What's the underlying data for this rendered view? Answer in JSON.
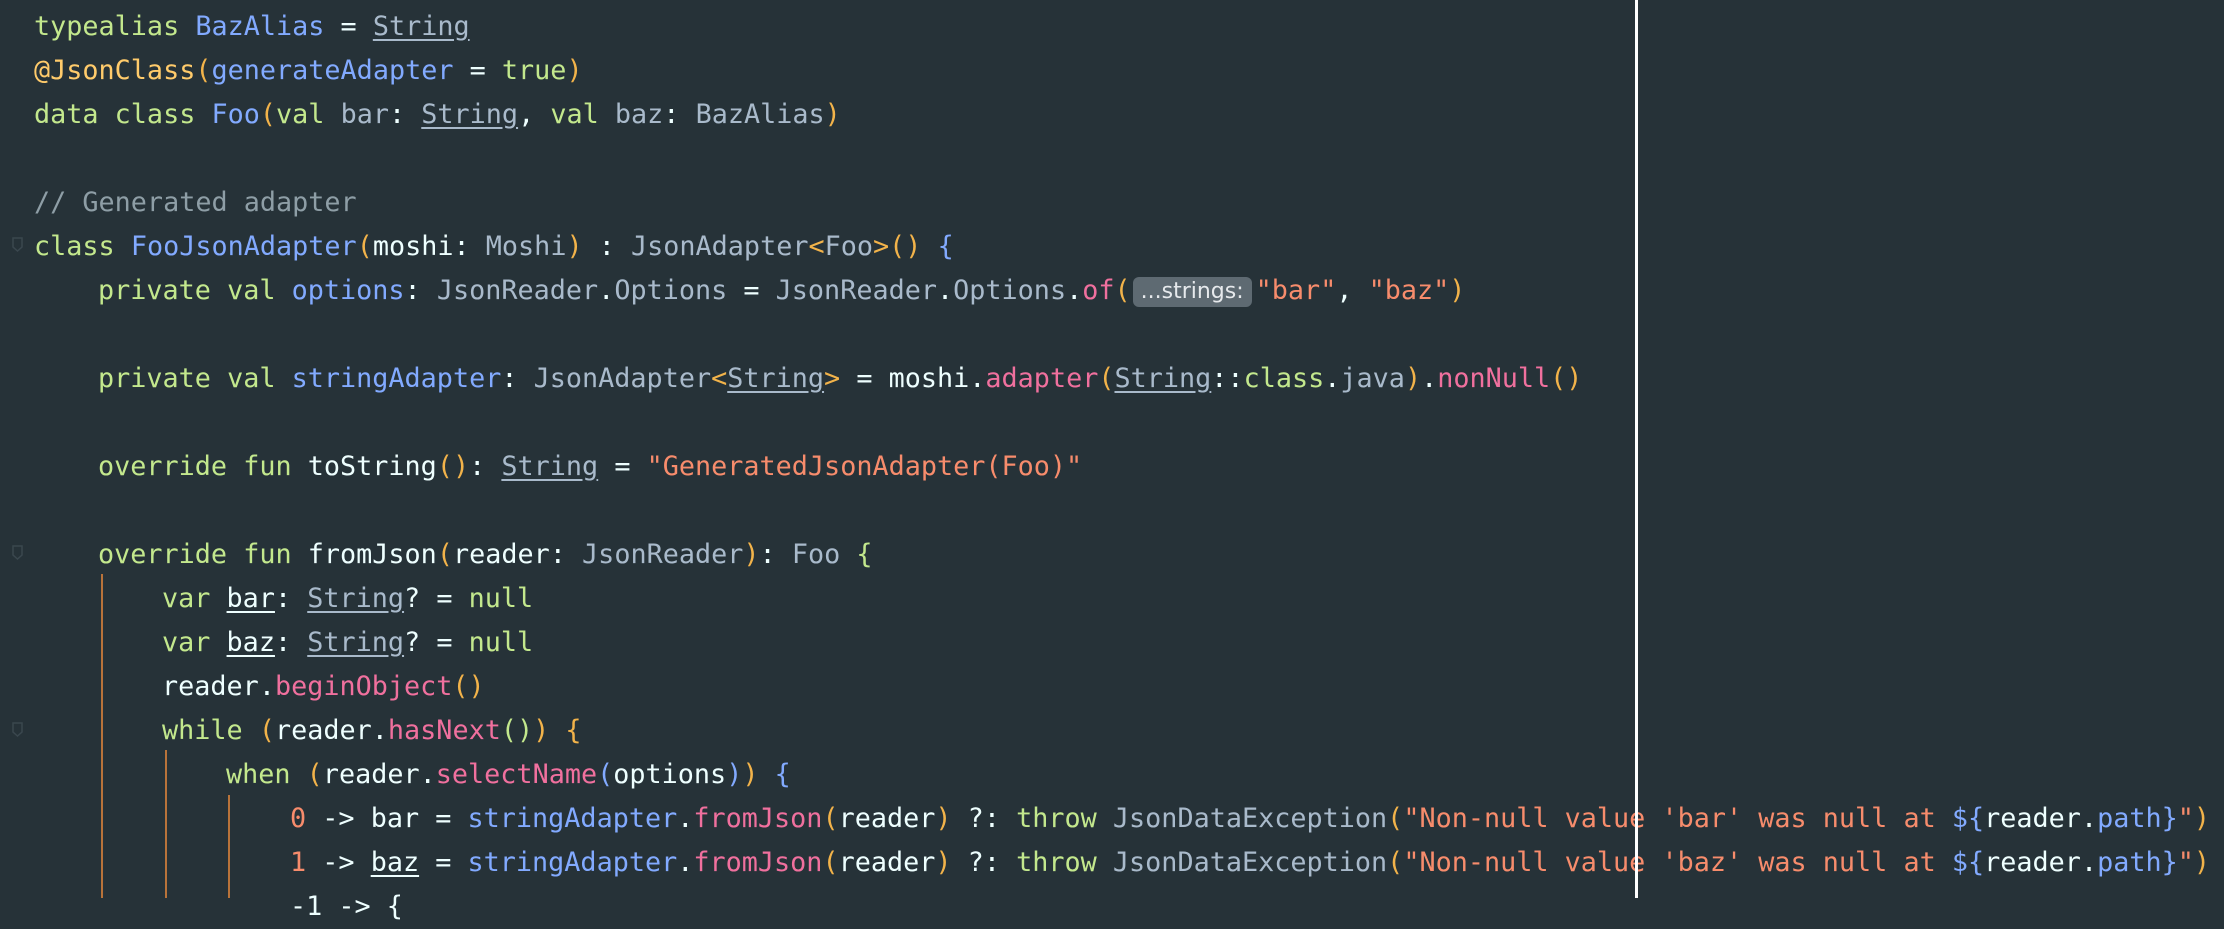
{
  "editor": {
    "lines": [
      {
        "indent": 0,
        "tokens": [
          {
            "t": "typealias ",
            "c": "kw"
          },
          {
            "t": "BazAlias",
            "c": "ty"
          },
          {
            "t": " = ",
            "c": "pl"
          },
          {
            "t": "String",
            "c": "ul"
          }
        ]
      },
      {
        "indent": 0,
        "tokens": [
          {
            "t": "@JsonClass",
            "c": "ann"
          },
          {
            "t": "(",
            "c": "par"
          },
          {
            "t": "generateAdapter",
            "c": "ty"
          },
          {
            "t": " = ",
            "c": "pl"
          },
          {
            "t": "true",
            "c": "kw"
          },
          {
            "t": ")",
            "c": "par"
          }
        ]
      },
      {
        "indent": 0,
        "tokens": [
          {
            "t": "data class ",
            "c": "kw"
          },
          {
            "t": "Foo",
            "c": "ty"
          },
          {
            "t": "(",
            "c": "par"
          },
          {
            "t": "val ",
            "c": "kw"
          },
          {
            "t": "bar",
            "c": "typ"
          },
          {
            "t": ": ",
            "c": "pl"
          },
          {
            "t": "String",
            "c": "ul"
          },
          {
            "t": ", ",
            "c": "pl"
          },
          {
            "t": "val ",
            "c": "kw"
          },
          {
            "t": "baz",
            "c": "typ"
          },
          {
            "t": ": ",
            "c": "pl"
          },
          {
            "t": "BazAlias",
            "c": "typ"
          },
          {
            "t": ")",
            "c": "par"
          }
        ]
      },
      {
        "indent": 0,
        "tokens": []
      },
      {
        "indent": 0,
        "tokens": [
          {
            "t": "// Generated adapter",
            "c": "cm"
          }
        ]
      },
      {
        "indent": 0,
        "tokens": [
          {
            "t": "class ",
            "c": "kw"
          },
          {
            "t": "FooJsonAdapter",
            "c": "ty"
          },
          {
            "t": "(",
            "c": "par"
          },
          {
            "t": "moshi",
            "c": "pl"
          },
          {
            "t": ": ",
            "c": "pl"
          },
          {
            "t": "Moshi",
            "c": "typ"
          },
          {
            "t": ")",
            "c": "par"
          },
          {
            "t": " : ",
            "c": "pl"
          },
          {
            "t": "JsonAdapter",
            "c": "typ"
          },
          {
            "t": "<",
            "c": "par"
          },
          {
            "t": "Foo",
            "c": "typ"
          },
          {
            "t": ">",
            "c": "par"
          },
          {
            "t": "()",
            "c": "par"
          },
          {
            "t": " {",
            "c": "ty"
          }
        ]
      },
      {
        "indent": 1,
        "tokens": [
          {
            "t": "private val ",
            "c": "kw"
          },
          {
            "t": "options",
            "c": "fld"
          },
          {
            "t": ": ",
            "c": "pl"
          },
          {
            "t": "JsonReader",
            "c": "typ"
          },
          {
            "t": ".",
            "c": "pl"
          },
          {
            "t": "Options",
            "c": "typ"
          },
          {
            "t": " = ",
            "c": "pl"
          },
          {
            "t": "JsonReader",
            "c": "typ"
          },
          {
            "t": ".",
            "c": "pl"
          },
          {
            "t": "Options",
            "c": "typ"
          },
          {
            "t": ".",
            "c": "pl"
          },
          {
            "t": "of",
            "c": "fn"
          },
          {
            "t": "(",
            "c": "par"
          },
          {
            "t": "...strings:",
            "c": "hint"
          },
          {
            "t": "\"bar\"",
            "c": "str"
          },
          {
            "t": ", ",
            "c": "pl"
          },
          {
            "t": "\"baz\"",
            "c": "str"
          },
          {
            "t": ")",
            "c": "par"
          }
        ]
      },
      {
        "indent": 0,
        "tokens": []
      },
      {
        "indent": 1,
        "tokens": [
          {
            "t": "private val ",
            "c": "kw"
          },
          {
            "t": "stringAdapter",
            "c": "fld"
          },
          {
            "t": ": ",
            "c": "pl"
          },
          {
            "t": "JsonAdapter",
            "c": "typ"
          },
          {
            "t": "<",
            "c": "par"
          },
          {
            "t": "String",
            "c": "ul"
          },
          {
            "t": ">",
            "c": "par"
          },
          {
            "t": " = ",
            "c": "pl"
          },
          {
            "t": "moshi",
            "c": "pl"
          },
          {
            "t": ".",
            "c": "pl"
          },
          {
            "t": "adapter",
            "c": "fn"
          },
          {
            "t": "(",
            "c": "par"
          },
          {
            "t": "String",
            "c": "ul"
          },
          {
            "t": "::",
            "c": "pl"
          },
          {
            "t": "class",
            "c": "kw"
          },
          {
            "t": ".",
            "c": "pl"
          },
          {
            "t": "java",
            "c": "typ"
          },
          {
            "t": ")",
            "c": "par"
          },
          {
            "t": ".",
            "c": "pl"
          },
          {
            "t": "nonNull",
            "c": "fn"
          },
          {
            "t": "()",
            "c": "par"
          }
        ]
      },
      {
        "indent": 0,
        "tokens": []
      },
      {
        "indent": 1,
        "tokens": [
          {
            "t": "override fun ",
            "c": "kw"
          },
          {
            "t": "toString",
            "c": "pl"
          },
          {
            "t": "()",
            "c": "par"
          },
          {
            "t": ": ",
            "c": "pl"
          },
          {
            "t": "String",
            "c": "ul"
          },
          {
            "t": " = ",
            "c": "pl"
          },
          {
            "t": "\"GeneratedJsonAdapter(Foo)\"",
            "c": "str"
          }
        ]
      },
      {
        "indent": 0,
        "tokens": []
      },
      {
        "indent": 1,
        "tokens": [
          {
            "t": "override fun ",
            "c": "kw"
          },
          {
            "t": "fromJson",
            "c": "pl"
          },
          {
            "t": "(",
            "c": "par"
          },
          {
            "t": "reader",
            "c": "pl"
          },
          {
            "t": ": ",
            "c": "pl"
          },
          {
            "t": "JsonReader",
            "c": "typ"
          },
          {
            "t": ")",
            "c": "par"
          },
          {
            "t": ": ",
            "c": "pl"
          },
          {
            "t": "Foo",
            "c": "typ"
          },
          {
            "t": " {",
            "c": "kw"
          }
        ]
      },
      {
        "indent": 2,
        "tokens": [
          {
            "t": "var ",
            "c": "kw"
          },
          {
            "t": "bar",
            "c": "ulw"
          },
          {
            "t": ": ",
            "c": "pl"
          },
          {
            "t": "String",
            "c": "ul"
          },
          {
            "t": "? = ",
            "c": "pl"
          },
          {
            "t": "null",
            "c": "nullk"
          }
        ]
      },
      {
        "indent": 2,
        "tokens": [
          {
            "t": "var ",
            "c": "kw"
          },
          {
            "t": "baz",
            "c": "ulw"
          },
          {
            "t": ": ",
            "c": "pl"
          },
          {
            "t": "String",
            "c": "ul"
          },
          {
            "t": "? = ",
            "c": "pl"
          },
          {
            "t": "null",
            "c": "nullk"
          }
        ]
      },
      {
        "indent": 2,
        "tokens": [
          {
            "t": "reader",
            "c": "pl"
          },
          {
            "t": ".",
            "c": "pl"
          },
          {
            "t": "beginObject",
            "c": "fn"
          },
          {
            "t": "()",
            "c": "par"
          }
        ]
      },
      {
        "indent": 2,
        "tokens": [
          {
            "t": "while ",
            "c": "kw"
          },
          {
            "t": "(",
            "c": "par"
          },
          {
            "t": "reader",
            "c": "pl"
          },
          {
            "t": ".",
            "c": "pl"
          },
          {
            "t": "hasNext",
            "c": "fn"
          },
          {
            "t": "()",
            "c": "kw"
          },
          {
            "t": ")",
            "c": "par"
          },
          {
            "t": " {",
            "c": "par"
          }
        ]
      },
      {
        "indent": 3,
        "tokens": [
          {
            "t": "when ",
            "c": "kw"
          },
          {
            "t": "(",
            "c": "par"
          },
          {
            "t": "reader",
            "c": "pl"
          },
          {
            "t": ".",
            "c": "pl"
          },
          {
            "t": "selectName",
            "c": "fn"
          },
          {
            "t": "(",
            "c": "ty"
          },
          {
            "t": "options",
            "c": "pl"
          },
          {
            "t": ")",
            "c": "ty"
          },
          {
            "t": ")",
            "c": "par"
          },
          {
            "t": " {",
            "c": "ty"
          }
        ]
      },
      {
        "indent": 4,
        "tokens": [
          {
            "t": "0",
            "c": "num"
          },
          {
            "t": " -> ",
            "c": "pl"
          },
          {
            "t": "bar",
            "c": "pl"
          },
          {
            "t": " = ",
            "c": "pl"
          },
          {
            "t": "stringAdapter",
            "c": "ty"
          },
          {
            "t": ".",
            "c": "pl"
          },
          {
            "t": "fromJson",
            "c": "fn"
          },
          {
            "t": "(",
            "c": "par"
          },
          {
            "t": "reader",
            "c": "pl"
          },
          {
            "t": ")",
            "c": "par"
          },
          {
            "t": " ?: ",
            "c": "pl"
          },
          {
            "t": "throw ",
            "c": "kw"
          },
          {
            "t": "JsonDataException",
            "c": "typ"
          },
          {
            "t": "(",
            "c": "par"
          },
          {
            "t": "\"Non-null value 'bar' was null at ",
            "c": "str"
          },
          {
            "t": "${",
            "c": "ty"
          },
          {
            "t": "reader",
            "c": "pl"
          },
          {
            "t": ".",
            "c": "pl"
          },
          {
            "t": "path",
            "c": "ty"
          },
          {
            "t": "}",
            "c": "ty"
          },
          {
            "t": "\"",
            "c": "str"
          },
          {
            "t": ")",
            "c": "par"
          }
        ]
      },
      {
        "indent": 4,
        "tokens": [
          {
            "t": "1",
            "c": "num"
          },
          {
            "t": " -> ",
            "c": "pl"
          },
          {
            "t": "baz",
            "c": "ulw"
          },
          {
            "t": " = ",
            "c": "pl"
          },
          {
            "t": "stringAdapter",
            "c": "ty"
          },
          {
            "t": ".",
            "c": "pl"
          },
          {
            "t": "fromJson",
            "c": "fn"
          },
          {
            "t": "(",
            "c": "par"
          },
          {
            "t": "reader",
            "c": "pl"
          },
          {
            "t": ")",
            "c": "par"
          },
          {
            "t": " ?: ",
            "c": "pl"
          },
          {
            "t": "throw ",
            "c": "kw"
          },
          {
            "t": "JsonDataException",
            "c": "typ"
          },
          {
            "t": "(",
            "c": "par"
          },
          {
            "t": "\"Non-null value 'baz' was null at ",
            "c": "str"
          },
          {
            "t": "${",
            "c": "ty"
          },
          {
            "t": "reader",
            "c": "pl"
          },
          {
            "t": ".",
            "c": "pl"
          },
          {
            "t": "path",
            "c": "ty"
          },
          {
            "t": "}",
            "c": "ty"
          },
          {
            "t": "\"",
            "c": "str"
          },
          {
            "t": ")",
            "c": "par"
          }
        ]
      },
      {
        "indent": 4,
        "tokens": [
          {
            "t": "-1 -> {",
            "c": "pl"
          }
        ]
      }
    ]
  }
}
